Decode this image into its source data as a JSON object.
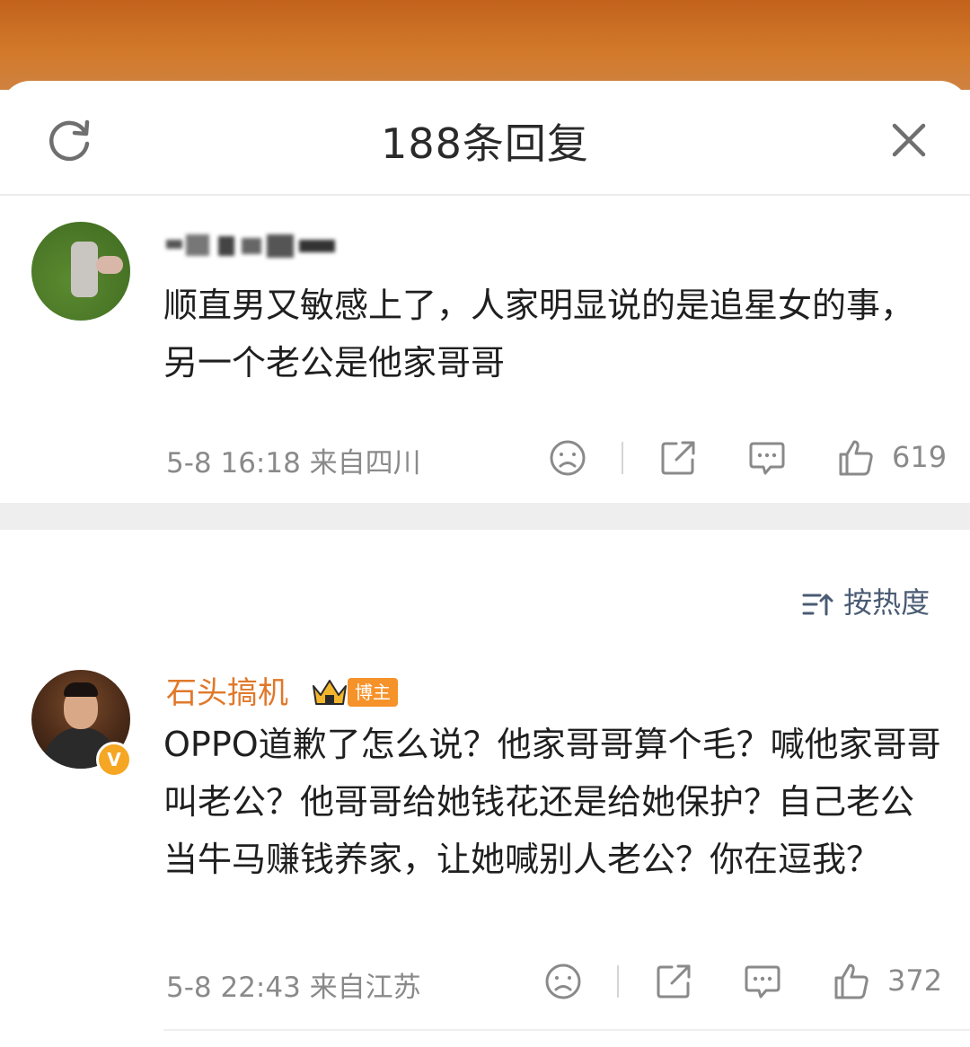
{
  "header": {
    "title": "188条回复",
    "refresh_icon": "refresh-icon",
    "close_icon": "close-icon"
  },
  "comments": [
    {
      "username": "__pixelated__",
      "text": "顺直男又敏感上了，人家明显说的是追星女的事，另一个老公是他家哥哥",
      "meta": "5-8 16:18  来自四川",
      "likes": "619"
    },
    {
      "username": "石头搞机",
      "badge": "博主",
      "text": "OPPO道歉了怎么说？他家哥哥算个毛？喊他家哥哥叫老公？他哥哥给她钱花还是给她保护？自己老公当牛马赚钱养家，让她喊别人老公？你在逗我？",
      "meta": "5-8 22:43  来自江苏",
      "likes": "372"
    }
  ],
  "sort": {
    "label": "按热度"
  },
  "colors": {
    "accent_orange": "#e0782a",
    "badge_orange": "#f6922a",
    "sort_blue": "#4a5b73",
    "meta_gray": "#8a8a8a"
  }
}
